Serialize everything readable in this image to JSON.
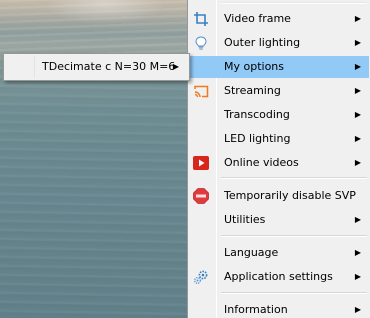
{
  "submenu": {
    "item_label": "TDecimate c N=30 M=6",
    "arrow": "▶"
  },
  "menu": {
    "arrow": "▶",
    "items": [
      {
        "label": "Video frame",
        "icon": "crop-frame-icon"
      },
      {
        "label": "Outer lighting",
        "icon": "lightbulb-icon"
      },
      {
        "label": "My options",
        "icon": ""
      },
      {
        "label": "Streaming",
        "icon": "cast-icon"
      },
      {
        "label": "Transcoding",
        "icon": ""
      },
      {
        "label": "LED lighting",
        "icon": ""
      },
      {
        "label": "Online videos",
        "icon": "play-icon"
      },
      {
        "label": "Temporarily disable SVP",
        "icon": "stop-icon"
      },
      {
        "label": "Utilities",
        "icon": ""
      },
      {
        "label": "Language",
        "icon": ""
      },
      {
        "label": "Application settings",
        "icon": "gears-icon"
      },
      {
        "label": "Information",
        "icon": ""
      }
    ]
  },
  "colors": {
    "menu_background": "#f0f0f0",
    "highlight": "#91c9f7",
    "play_icon": "#d9261c",
    "cast_icon": "#f07a1e",
    "stop_icon": "#e0393e",
    "blue_icon": "#3a7fc4"
  }
}
